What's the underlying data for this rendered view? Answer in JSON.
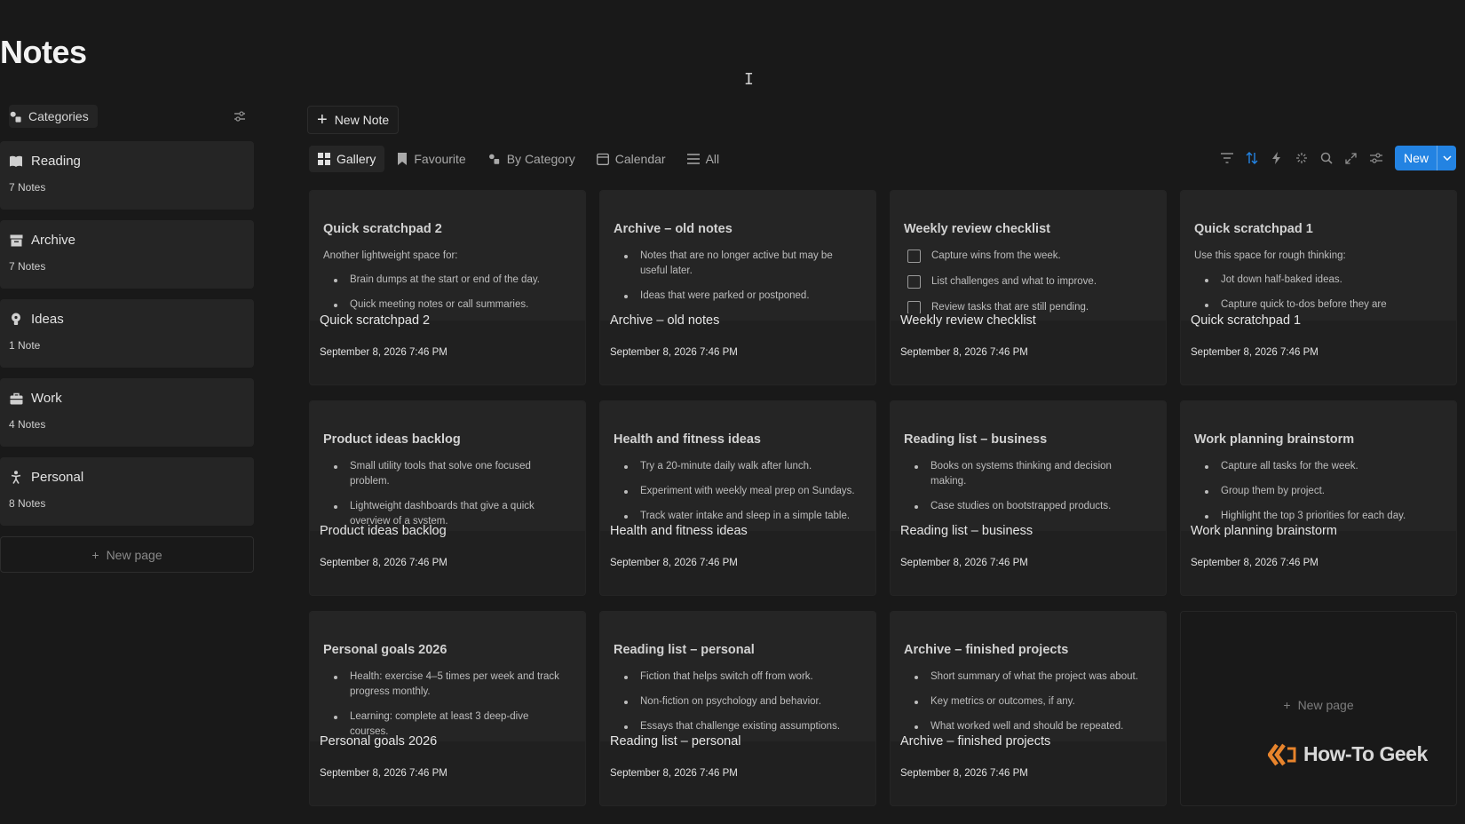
{
  "page": {
    "title": "Notes"
  },
  "sidebar": {
    "header_label": "Categories",
    "categories": [
      {
        "name": "Reading",
        "count": "7 Notes",
        "icon": "book-icon"
      },
      {
        "name": "Archive",
        "count": "7 Notes",
        "icon": "archive-box-icon"
      },
      {
        "name": "Ideas",
        "count": "1 Note",
        "icon": "lightbulb-icon"
      },
      {
        "name": "Work",
        "count": "4 Notes",
        "icon": "briefcase-icon"
      },
      {
        "name": "Personal",
        "count": "8 Notes",
        "icon": "person-icon"
      }
    ],
    "new_page_label": "New page"
  },
  "toolbar": {
    "new_note_label": "New Note",
    "views": [
      "Gallery",
      "Favourite",
      "By Category",
      "Calendar",
      "All"
    ],
    "active_view": "Gallery",
    "new_button_label": "New",
    "accent_color": "#2383e2"
  },
  "cards": [
    {
      "title": "Quick scratchpad 2",
      "intro": "Another lightweight space for:",
      "bullets": [
        "Brain dumps at the start or end of the day.",
        "Quick meeting notes or call summaries."
      ],
      "date": "September 8, 2026 7:46 PM"
    },
    {
      "title": "Archive – old notes",
      "bullets": [
        "Notes that are no longer active but may be useful later.",
        "Ideas that were parked or postponed."
      ],
      "date": "September 8, 2026 7:46 PM"
    },
    {
      "title": "Weekly review checklist",
      "checks": [
        "Capture wins from the week.",
        "List challenges and what to improve.",
        "Review tasks that are still pending."
      ],
      "date": "September 8, 2026 7:46 PM"
    },
    {
      "title": "Quick scratchpad 1",
      "intro": "Use this space for rough thinking:",
      "bullets": [
        "Jot down half-baked ideas.",
        "Capture quick to-dos before they are"
      ],
      "date": "September 8, 2026 7:46 PM"
    },
    {
      "title": "Product ideas backlog",
      "bullets": [
        "Small utility tools that solve one focused problem.",
        "Lightweight dashboards that give a quick overview of a system."
      ],
      "date": "September 8, 2026 7:46 PM"
    },
    {
      "title": "Health and fitness ideas",
      "bullets": [
        "Try a 20-minute daily walk after lunch.",
        "Experiment with weekly meal prep on Sundays.",
        "Track water intake and sleep in a simple table."
      ],
      "date": "September 8, 2026 7:46 PM"
    },
    {
      "title": "Reading list – business",
      "bullets": [
        "Books on systems thinking and decision making.",
        "Case studies on bootstrapped products."
      ],
      "date": "September 8, 2026 7:46 PM"
    },
    {
      "title": "Work planning brainstorm",
      "bullets": [
        "Capture all tasks for the week.",
        "Group them by project.",
        "Highlight the top 3 priorities for each day."
      ],
      "date": "September 8, 2026 7:46 PM"
    },
    {
      "title": "Personal goals 2026",
      "bullets": [
        "Health: exercise 4–5 times per week and track progress monthly.",
        "Learning: complete at least 3 deep-dive courses."
      ],
      "date": "September 8, 2026 7:46 PM"
    },
    {
      "title": "Reading list – personal",
      "bullets": [
        "Fiction that helps switch off from work.",
        "Non-fiction on psychology and behavior.",
        "Essays that challenge existing assumptions."
      ],
      "date": "September 8, 2026 7:46 PM"
    },
    {
      "title": "Archive – finished projects",
      "bullets": [
        "Short summary of what the project was about.",
        "Key metrics or outcomes, if any.",
        "What worked well and should be repeated."
      ],
      "date": "September 8, 2026 7:46 PM"
    }
  ],
  "gallery_new_page_label": "New page",
  "watermark": {
    "text": "How-To Geek"
  }
}
